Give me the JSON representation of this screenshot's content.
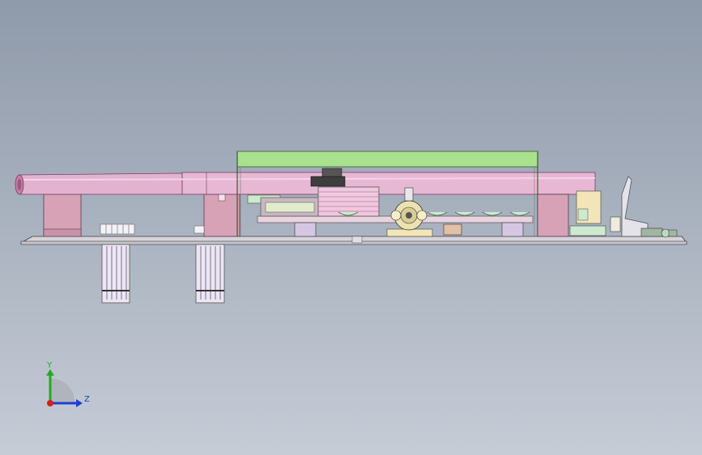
{
  "viewport": {
    "background_top": "#8f9aaa",
    "background_bottom": "#c6ccd6"
  },
  "model": {
    "colors": {
      "pipe": "#e3b2d0",
      "pipe_edge": "#7a3b62",
      "support": "#d7a2b6",
      "frame": "#a8e28e",
      "base": "#d2d0d6",
      "block": "#f1c6de",
      "green_part": "#cbead0",
      "leg": "#e7ddef",
      "motor": "#f2e6b8",
      "edge": "#3a3a3a"
    }
  },
  "triad": {
    "x_label": "Y",
    "z_label": "Z",
    "y_color": "#22aa22",
    "z_color": "#1f3fd0",
    "x_color": "#d02020"
  }
}
